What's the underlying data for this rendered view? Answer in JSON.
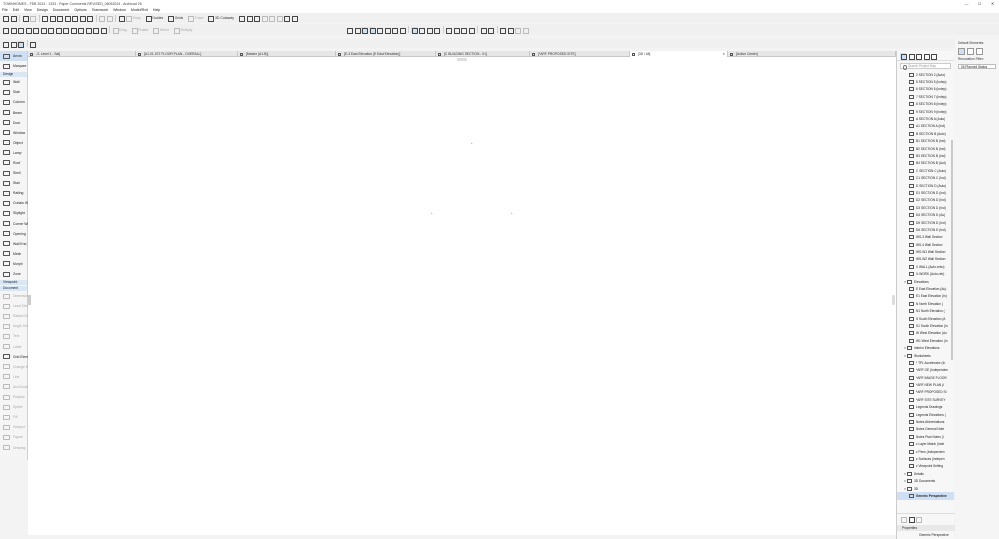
{
  "window": {
    "title": "TOWNHOMES - FEB 2024 - 1333 - Paper Comments REVISED_06052024 - Archicad 26",
    "controls": [
      "—",
      "☐",
      "✕"
    ]
  },
  "menu": [
    "File",
    "Edit",
    "View",
    "Design",
    "Document",
    "Options",
    "Teamwork",
    "Window",
    "Model/Rvit",
    "Help"
  ],
  "toolbar": {
    "grids_label": "Grids",
    "guides_label": "Guides",
    "snap_label": "Snap",
    "trace_label": "Trace",
    "cutaway_label": "3D Cutaway",
    "drag_label": "Drag",
    "rotate_label": "Rotate",
    "mirror_label": "Mirror",
    "multiply_label": "Multiply"
  },
  "tabs": [
    {
      "label": "-3. Level 1 - Sat]",
      "active": false
    },
    {
      "label": "[A1.01 1ST FLOOR PLAN - OVERALL]",
      "active": false
    },
    {
      "label": "[Master (A1-B)]",
      "active": false
    },
    {
      "label": "[E-3 East Elevation (E East Elevation)]",
      "active": false
    },
    {
      "label": "[C BUILDING SECTION - 01]",
      "active": false
    },
    {
      "label": "[*ARF PROPOSED SITE]",
      "active": false
    },
    {
      "label": "[3D / All]",
      "active": true
    },
    {
      "label": "[Action Center]",
      "active": false
    }
  ],
  "toolbox": {
    "sections": [
      {
        "header": "Arrow",
        "items": []
      },
      {
        "header": "",
        "items": [
          "Marquee"
        ]
      },
      {
        "header": "Design",
        "items": [
          "Wall",
          "Slab",
          "Column",
          "Beam",
          "Door",
          "Window",
          "Object",
          "Lamp",
          "Roof",
          "Shell",
          "Stair",
          "Railing",
          "Curtain Wall",
          "Skylight",
          "Corner Window",
          "Opening",
          "Wall End",
          "Mesh",
          "Morph",
          "Zone"
        ]
      },
      {
        "header": "Viewpoint",
        "items": []
      },
      {
        "header": "Document",
        "items": [
          "Dimension",
          "Level Dim",
          "Radial Dim",
          "Angle Dim",
          "Text",
          "Label",
          "Grid Element",
          "Change Marker",
          "Line",
          "Arc/Circle",
          "Polyline",
          "Spline",
          "Fill",
          "Hotspot",
          "Figure",
          "Drawing"
        ]
      }
    ],
    "arrow_label": "Arrow"
  },
  "canvas": {
    "marks": [
      "+",
      "+",
      "+"
    ],
    "hint": ""
  },
  "navigator": {
    "search_placeholder": "Search Project Map",
    "rows": [
      {
        "label": "2 SECTION 2 (Auto)",
        "type": "item"
      },
      {
        "label": "5 SECTION 5 (Indep)",
        "type": "item"
      },
      {
        "label": "6 SECTION 6 (Indep)",
        "type": "item"
      },
      {
        "label": "7 SECTION 7 (Indep)",
        "type": "item"
      },
      {
        "label": "8 SECTION 8 (Indep)",
        "type": "item"
      },
      {
        "label": "9 SECTION 9 (Indep)",
        "type": "item"
      },
      {
        "label": "A SECTION A (Auto)",
        "type": "item"
      },
      {
        "label": "A1 SECTION A (Ind)",
        "type": "item"
      },
      {
        "label": "B SECTION B (Auto)",
        "type": "item"
      },
      {
        "label": "B1 SECTION B (Ind)",
        "type": "item"
      },
      {
        "label": "B2 SECTION B (Ind)",
        "type": "item"
      },
      {
        "label": "B3 SECTION B (Ind)",
        "type": "item"
      },
      {
        "label": "B4 SECTION B (Aut)",
        "type": "item"
      },
      {
        "label": "C SECTION C (Auto)",
        "type": "item"
      },
      {
        "label": "C1 SECTION C (Ind)",
        "type": "item"
      },
      {
        "label": "D SECTION D (Auto)",
        "type": "item"
      },
      {
        "label": "D1 SECTION D (Ind)",
        "type": "item"
      },
      {
        "label": "D2 SECTION D (Ind)",
        "type": "item"
      },
      {
        "label": "D3 SECTION D (Ind)",
        "type": "item"
      },
      {
        "label": "D4 SECTION D (Au)",
        "type": "item"
      },
      {
        "label": "D5 SECTION D (Ind)",
        "type": "item"
      },
      {
        "label": "D6 SECTION D (Ind)",
        "type": "item"
      },
      {
        "label": "WS-3 Wall Section",
        "type": "item"
      },
      {
        "label": "WS-4 Wall Section",
        "type": "item"
      },
      {
        "label": "WS-W1 Wall Section",
        "type": "item"
      },
      {
        "label": "WS-W2 Wall Section",
        "type": "item"
      },
      {
        "label": "X WALL (Auto-rebu)",
        "type": "item"
      },
      {
        "label": "X-WORK (Auto-reb)",
        "type": "item"
      },
      {
        "label": "Elevations",
        "type": "folder"
      },
      {
        "label": "E East Elevation (Au)",
        "type": "item"
      },
      {
        "label": "E1 East Elevation (In)",
        "type": "item"
      },
      {
        "label": "N North Elevation (",
        "type": "item"
      },
      {
        "label": "N1 North Elevation (",
        "type": "item"
      },
      {
        "label": "S South Elevation (A",
        "type": "item"
      },
      {
        "label": "S1 South Elevation (In",
        "type": "item"
      },
      {
        "label": "W West Elevation (Au",
        "type": "item"
      },
      {
        "label": "W1 West Elevation (In",
        "type": "item"
      },
      {
        "label": "Interior Elevations",
        "type": "folder"
      },
      {
        "label": "Worksheets",
        "type": "folder"
      },
      {
        "label": "* TPL Accelerator (In",
        "type": "item"
      },
      {
        "label": "*ARF GE (Independen",
        "type": "item"
      },
      {
        "label": "*ARF IMAGE FLOOR",
        "type": "item"
      },
      {
        "label": "*ARF NEW PLAN (I",
        "type": "item"
      },
      {
        "label": "*ARF PROPOSED SI",
        "type": "item"
      },
      {
        "label": "*ARF SITE SURVEY",
        "type": "item"
      },
      {
        "label": "Legends Drawings",
        "type": "item"
      },
      {
        "label": "Legends Elevations (",
        "type": "item"
      },
      {
        "label": "Notes Abbreviations",
        "type": "item"
      },
      {
        "label": "Notes General Note",
        "type": "item"
      },
      {
        "label": "Notes Plan Notes (I",
        "type": "item"
      },
      {
        "label": "z Layer Matrix (Inde",
        "type": "item"
      },
      {
        "label": "z Pens (Independen",
        "type": "item"
      },
      {
        "label": "z Surfaces (Indepen",
        "type": "item"
      },
      {
        "label": "z Viewpoint Setting",
        "type": "item"
      },
      {
        "label": "Details",
        "type": "folder"
      },
      {
        "label": "3D Documents",
        "type": "folder"
      },
      {
        "label": "3D",
        "type": "folder"
      },
      {
        "label": "Generic Perspective",
        "type": "selected"
      }
    ],
    "properties_label": "Properties",
    "properties_value": "Generic Perspective"
  },
  "far_panel": {
    "default_elements_label": "Default Elements:",
    "renovation_filter_label": "Renovation Filter:",
    "renovation_filter_value": "06 Planned Status"
  }
}
